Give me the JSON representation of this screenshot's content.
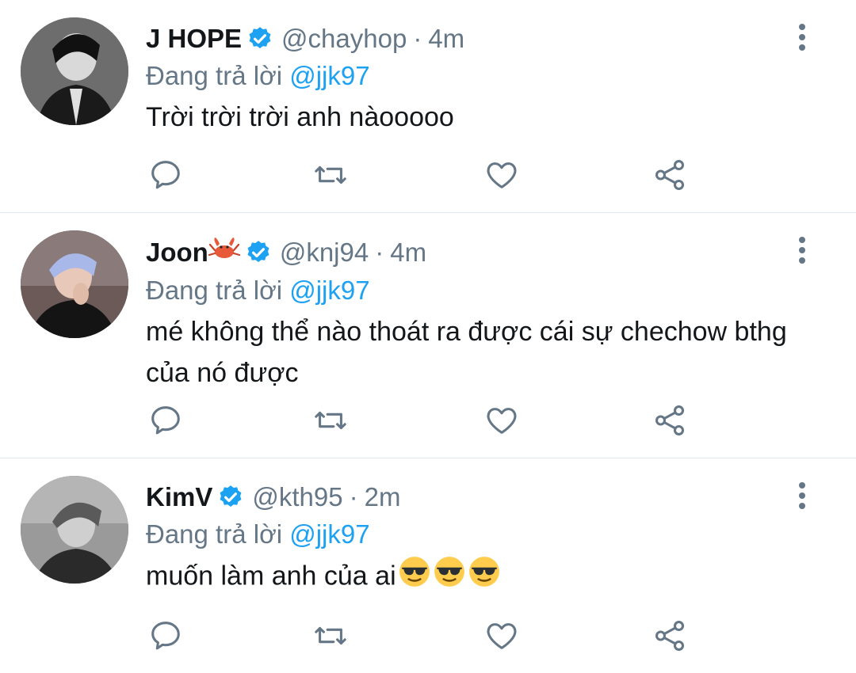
{
  "reply_prefix": "Đang trả lời",
  "tweets": [
    {
      "name": "J HOPE",
      "handle": "@chayhop",
      "time": "4m",
      "reply_to": "@jjk97",
      "text": "Trời trời trời anh nàooooo",
      "text_emojis": [],
      "name_emoji": "",
      "avatar": "grayscale-photo"
    },
    {
      "name": "Joon",
      "handle": "@knj94",
      "time": "4m",
      "reply_to": "@jjk97",
      "text": "mé không thể nào thoát ra được cái sự chechow bthg của nó được",
      "text_emojis": [],
      "name_emoji": "crab-emoji",
      "avatar": "color-photo"
    },
    {
      "name": "KimV",
      "handle": "@kth95",
      "time": "2m",
      "reply_to": "@jjk97",
      "text": "muốn làm anh của ai",
      "text_emojis": [
        "sunglasses-emoji",
        "sunglasses-emoji",
        "sunglasses-emoji"
      ],
      "name_emoji": "",
      "avatar": "grayscale-photo"
    }
  ],
  "separator": "·",
  "colors": {
    "accent": "#1da1f2",
    "secondary_text": "#657786",
    "primary_text": "#14171a",
    "divider": "#e1e8ed"
  },
  "icons": {
    "verified": "verified-badge-icon",
    "more": "more-vertical-icon",
    "reply": "reply-icon",
    "retweet": "retweet-icon",
    "like": "heart-icon",
    "share": "share-icon"
  }
}
